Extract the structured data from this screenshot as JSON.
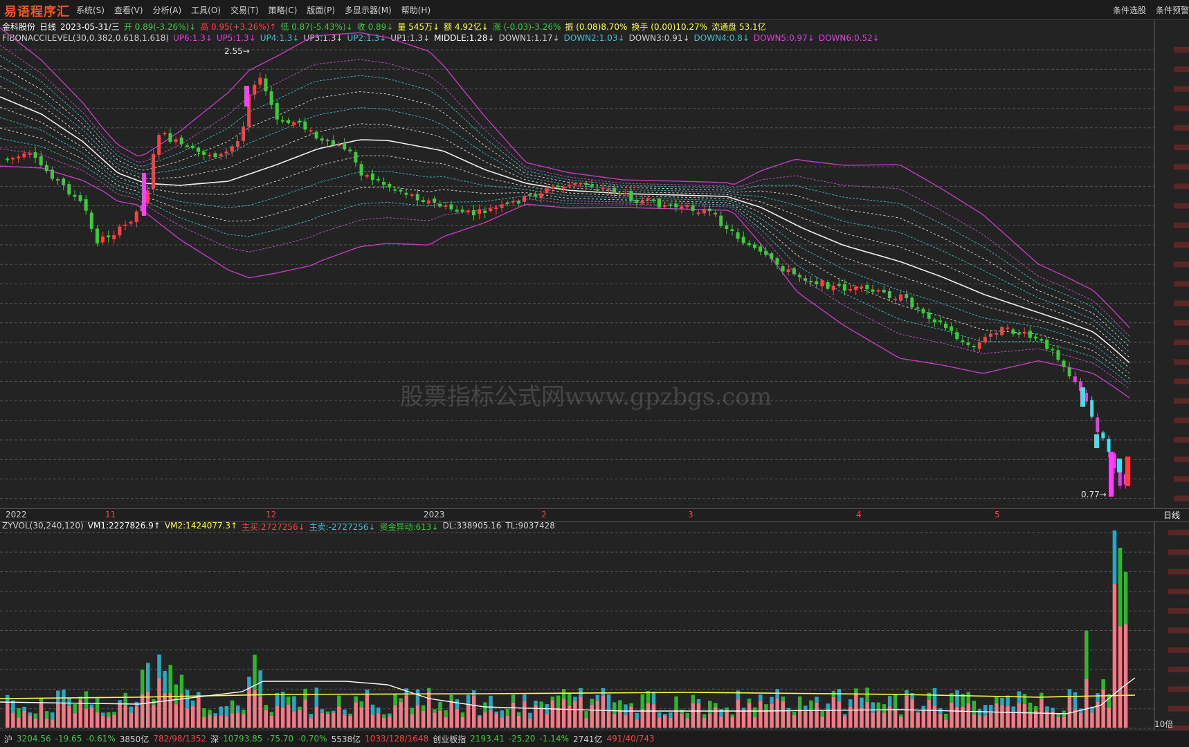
{
  "app": {
    "logo": "易语程序汇",
    "right_menu": [
      "条件选股",
      "条件预警"
    ]
  },
  "menu": [
    "系统(S)",
    "查看(V)",
    "分析(A)",
    "工具(O)",
    "交易(T)",
    "策略(C)",
    "版面(P)",
    "多显示器(M)",
    "帮助(H)"
  ],
  "quote": {
    "name": "金科股份",
    "period": "日线",
    "date": "2023-05-31/三",
    "items": [
      {
        "t": "开 0.89(-3.26%)",
        "c": "#3ec93e",
        "a": "↓"
      },
      {
        "t": "高 0.95(+3.26%)",
        "c": "#ff4040",
        "a": "↑"
      },
      {
        "t": "低 0.87(-5.43%)",
        "c": "#3ec93e",
        "a": "↓"
      },
      {
        "t": "收 0.89",
        "c": "#3ec93e",
        "a": "↓"
      },
      {
        "t": "量 545万",
        "c": "#ffff40",
        "a": "↓"
      },
      {
        "t": "额 4.92亿",
        "c": "#ffff40",
        "a": "↓"
      },
      {
        "t": "涨 (-0.03)-3.26%",
        "c": "#3ec93e",
        "a": ""
      },
      {
        "t": "振 (0.08)8.70%",
        "c": "#ffff40",
        "a": ""
      },
      {
        "t": "换手 (0.00)10.27%",
        "c": "#ffff40",
        "a": ""
      },
      {
        "t": "流通盘 53.1亿",
        "c": "#ffff40",
        "a": ""
      }
    ]
  },
  "fib": {
    "name": "FIBONACCILEVEL(30,0.382,0.618,1.618)",
    "items": [
      {
        "t": "UP6:1.3",
        "c": "#e040e0"
      },
      {
        "t": "UP5:1.3",
        "c": "#e040e0"
      },
      {
        "t": "UP4:1.3",
        "c": "#40c0d0"
      },
      {
        "t": "UP3:1.3",
        "c": "#d0d0d0"
      },
      {
        "t": "UP2:1.3",
        "c": "#40c0d0"
      },
      {
        "t": "UP1:1.3",
        "c": "#d0d0d0"
      },
      {
        "t": "MIDDLE:1.28",
        "c": "#ffffff"
      },
      {
        "t": "DOWN1:1.17",
        "c": "#d0d0d0"
      },
      {
        "t": "DOWN2:1.03",
        "c": "#40c0d0"
      },
      {
        "t": "DOWN3:0.91",
        "c": "#d0d0d0"
      },
      {
        "t": "DOWN4:0.8",
        "c": "#40c0d0"
      },
      {
        "t": "DOWN5:0.97",
        "c": "#e040e0"
      },
      {
        "t": "DOWN6:0.52",
        "c": "#e040e0"
      }
    ]
  },
  "annotations": {
    "high": "2.55",
    "low": "0.77"
  },
  "xaxis": [
    {
      "t": "2022",
      "c": "#d0d0d0"
    },
    {
      "t": "11",
      "c": "#ff4040"
    },
    {
      "t": "12",
      "c": "#ff4040"
    },
    {
      "t": "2023",
      "c": "#d0d0d0"
    },
    {
      "t": "2",
      "c": "#ff4040"
    },
    {
      "t": "3",
      "c": "#ff4040"
    },
    {
      "t": "4",
      "c": "#ff4040"
    },
    {
      "t": "5",
      "c": "#ff4040"
    }
  ],
  "period_label": "日线",
  "vol": {
    "name": "ZYVOL(30,240,120)",
    "items": [
      {
        "t": "VM1:2227826.9",
        "c": "#ffffff",
        "a": "↑"
      },
      {
        "t": "VM2:1424077.3",
        "c": "#ffff40",
        "a": "↑"
      },
      {
        "t": "主买:2727256",
        "c": "#ff4040",
        "a": "↓"
      },
      {
        "t": "主卖:-2727256",
        "c": "#40c0d0",
        "a": "↓"
      },
      {
        "t": "资金异动:613",
        "c": "#3ec93e",
        "a": "↓"
      },
      {
        "t": "DL:338905.16",
        "c": "#d0d0d0",
        "a": ""
      },
      {
        "t": "TL:9037428",
        "c": "#d0d0d0",
        "a": ""
      }
    ],
    "scale_label": "10倍"
  },
  "status": [
    {
      "t": "沪",
      "c": "#d0d0d0"
    },
    {
      "t": "3204.56",
      "c": "#3ec93e"
    },
    {
      "t": "-19.65",
      "c": "#3ec93e"
    },
    {
      "t": "-0.61%",
      "c": "#3ec93e"
    },
    {
      "t": "3850亿",
      "c": "#d0d0d0"
    },
    {
      "t": "782/98/1352",
      "c": "#ff4040"
    },
    {
      "t": "深",
      "c": "#d0d0d0"
    },
    {
      "t": "10793.85",
      "c": "#3ec93e"
    },
    {
      "t": "-75.70",
      "c": "#3ec93e"
    },
    {
      "t": "-0.70%",
      "c": "#3ec93e"
    },
    {
      "t": "5538亿",
      "c": "#d0d0d0"
    },
    {
      "t": "1033/128/1648",
      "c": "#ff4040"
    },
    {
      "t": "创业板指",
      "c": "#d0d0d0"
    },
    {
      "t": "2193.41",
      "c": "#3ec93e"
    },
    {
      "t": "-25.20",
      "c": "#3ec93e"
    },
    {
      "t": "-1.14%",
      "c": "#3ec93e"
    },
    {
      "t": "2741亿",
      "c": "#d0d0d0"
    },
    {
      "t": "491/40/743",
      "c": "#ff4040"
    }
  ],
  "watermark": "股票指标公式网www.gpzbgs.com"
}
